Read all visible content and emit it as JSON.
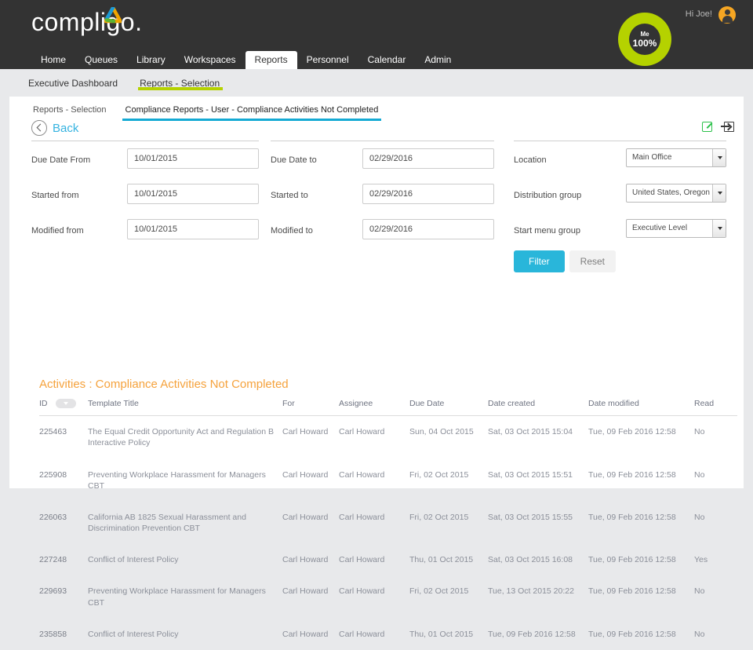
{
  "header": {
    "logo_text": "compligo.",
    "logo_mark_icon": "triangle-ring-icon",
    "greeting": "Hi Joe!",
    "avatar_icon": "user-avatar-icon",
    "score_badge": {
      "label": "Me",
      "value": "100%"
    }
  },
  "mainnav": {
    "items": [
      {
        "label": "Home",
        "active": false
      },
      {
        "label": "Queues",
        "active": false
      },
      {
        "label": "Library",
        "active": false
      },
      {
        "label": "Workspaces",
        "active": false
      },
      {
        "label": "Reports",
        "active": true
      },
      {
        "label": "Personnel",
        "active": false
      },
      {
        "label": "Calendar",
        "active": false
      },
      {
        "label": "Admin",
        "active": false
      }
    ]
  },
  "breadcrumbs": {
    "items": [
      {
        "label": "Executive Dashboard",
        "active": false
      },
      {
        "label": "Reports - Selection",
        "active": true
      }
    ]
  },
  "subtabs": {
    "items": [
      {
        "label": "Reports - Selection",
        "active": false
      },
      {
        "label": "Compliance Reports - User - Compliance Activities Not Completed",
        "active": true
      }
    ]
  },
  "toolbar": {
    "back_label": "Back",
    "back_icon": "chevron-left-circle-icon",
    "edit_icon": "edit-pencil-icon",
    "export_icon": "export-arrow-icon"
  },
  "filters": {
    "column1": [
      {
        "label": "Due Date From",
        "value": "10/01/2015",
        "placeholder": "mm/dd/yyyy"
      },
      {
        "label": "Started from",
        "value": "10/01/2015",
        "placeholder": "mm/dd/yyyy"
      },
      {
        "label": "Modified from",
        "value": "10/01/2015",
        "placeholder": "mm/dd/yyyy"
      }
    ],
    "column2": [
      {
        "label": "Due Date to",
        "value": "02/29/2016",
        "placeholder": "mm/dd/yyyy"
      },
      {
        "label": "Started to",
        "value": "02/29/2016",
        "placeholder": "mm/dd/yyyy"
      },
      {
        "label": "Modified to",
        "value": "02/29/2016",
        "placeholder": "mm/dd/yyyy"
      }
    ],
    "column3": [
      {
        "label": "Location",
        "value": "Main Office"
      },
      {
        "label": "Distribution group",
        "value": "United States, Oregon"
      },
      {
        "label": "Start menu group",
        "value": "Executive Level"
      }
    ],
    "filter_button": "Filter",
    "reset_button": "Reset"
  },
  "activities": {
    "title": "Activities : Compliance Activities Not Completed",
    "sort_icon": "sort-descending-icon",
    "columns": [
      "ID",
      "Template Title",
      "For",
      "Assignee",
      "Due Date",
      "Date created",
      "Date modified",
      "Read"
    ],
    "rows": [
      {
        "id": "225463",
        "title": "The Equal Credit Opportunity Act and Regulation B Interactive Policy",
        "for": "Carl Howard",
        "assignee": "Carl Howard",
        "due_date": "Sun, 04 Oct 2015",
        "date_created": "Sat, 03 Oct 2015 15:04",
        "date_modified": "Tue, 09 Feb 2016 12:58",
        "read": "No"
      },
      {
        "id": "225908",
        "title": "Preventing Workplace Harassment for Managers CBT",
        "for": "Carl Howard",
        "assignee": "Carl Howard",
        "due_date": "Fri, 02 Oct 2015",
        "date_created": "Sat, 03 Oct 2015 15:51",
        "date_modified": "Tue, 09 Feb 2016 12:58",
        "read": "No"
      },
      {
        "id": "226063",
        "title": "California AB 1825 Sexual Harassment and Discrimination Prevention CBT",
        "for": "Carl Howard",
        "assignee": "Carl Howard",
        "due_date": "Fri, 02 Oct 2015",
        "date_created": "Sat, 03 Oct 2015 15:55",
        "date_modified": "Tue, 09 Feb 2016 12:58",
        "read": "No"
      },
      {
        "id": "227248",
        "title": "Conflict of Interest Policy",
        "for": "Carl Howard",
        "assignee": "Carl Howard",
        "due_date": "Thu, 01 Oct 2015",
        "date_created": "Sat, 03 Oct 2015 16:08",
        "date_modified": "Tue, 09 Feb 2016 12:58",
        "read": "Yes"
      },
      {
        "id": "229693",
        "title": "Preventing Workplace Harassment for Managers CBT",
        "for": "Carl Howard",
        "assignee": "Carl Howard",
        "due_date": "Fri, 02 Oct 2015",
        "date_created": "Tue, 13 Oct 2015 20:22",
        "date_modified": "Tue, 09 Feb 2016 12:58",
        "read": "No"
      },
      {
        "id": "235858",
        "title": "Conflict of Interest Policy",
        "for": "Carl Howard",
        "assignee": "Carl Howard",
        "due_date": "Thu, 01 Oct 2015",
        "date_created": "Tue, 09 Feb 2016 12:58",
        "date_modified": "Tue, 09 Feb 2016 12:58",
        "read": "No"
      }
    ]
  },
  "colors": {
    "dark_bar": "#333333",
    "accent_green": "#b5d200",
    "accent_cyan": "#14aad4",
    "title_orange": "#f5a23c",
    "avatar_orange": "#f5a623"
  }
}
